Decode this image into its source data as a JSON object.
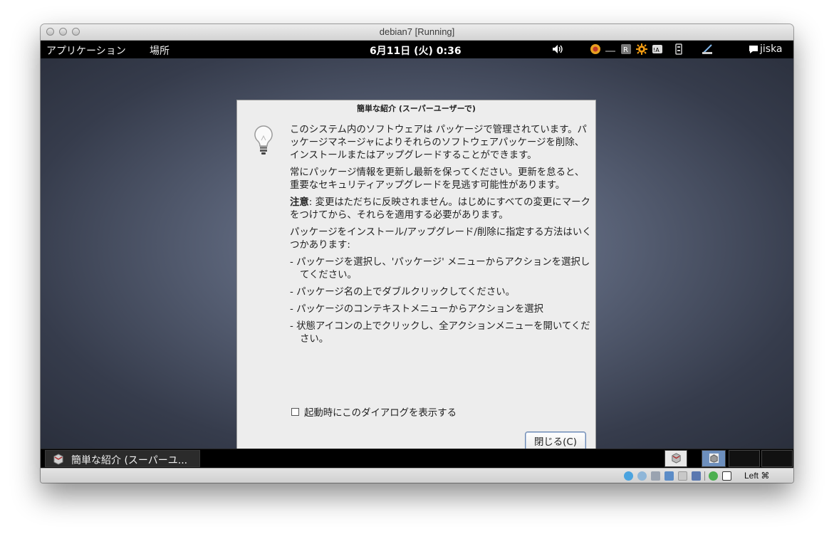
{
  "window": {
    "title": "debian7 [Running]"
  },
  "top_panel": {
    "applications_label": "アプリケーション",
    "places_label": "場所",
    "clock": "6月11日 (火) 0:36",
    "user": "jiska"
  },
  "dialog": {
    "title": "簡単な紹介 (スーパーユーザーで)",
    "paragraphs": [
      "このシステム内のソフトウェアは パッケージで管理されています。パッケージマネージャによりそれらのソフトウェアパッケージを削除、インストールまたはアップグレードすることができます。",
      "常にパッケージ情報を更新し最新を保ってください。更新を怠ると、重要なセキュリティアップグレードを見逃す可能性があります。"
    ],
    "note_bold": "注意",
    "note_text": ": 変更はただちに反映されません。はじめにすべての変更にマークをつけてから、それらを適用する必要があります。",
    "methods_intro": "パッケージをインストール/アップグレード/削除に指定する方法はいくつかあります:",
    "methods": [
      "- パッケージを選択し、'パッケージ' メニューからアクションを選択してください。",
      "- パッケージ名の上でダブルクリックしてください。",
      "- パッケージのコンテキストメニューからアクションを選択",
      "- 状態アイコンの上でクリックし、全アクションメニューを開いてください。"
    ],
    "checkbox_label": "起動時にこのダイアログを表示する",
    "checkbox_checked": false,
    "close_button": "閉じる(C)"
  },
  "taskbar": {
    "task_label": "簡単な紹介 (スーパーユ..."
  },
  "statusbar": {
    "host_key": "Left ⌘"
  }
}
